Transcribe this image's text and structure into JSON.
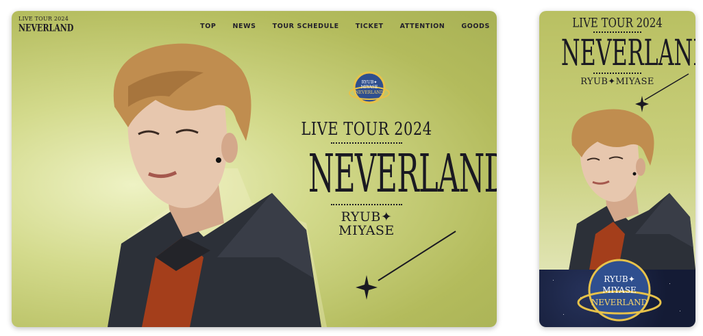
{
  "desktop": {
    "logo": {
      "line1": "LIVE TOUR 2024",
      "line2": "NEVERLAND"
    },
    "nav": [
      "TOP",
      "NEWS",
      "TOUR SCHEDULE",
      "TICKET",
      "ATTENTION",
      "GOODS"
    ],
    "hero": {
      "subtitle": "LIVE TOUR 2024",
      "title": "NEVERLAND",
      "artist_line1": "RYUB✦",
      "artist_line2": "MIYASE"
    },
    "badge": {
      "line1": "RYUB✦",
      "line2": "MIYASE",
      "line3": "NEVERLAND"
    }
  },
  "mobile": {
    "subtitle": "LIVE TOUR 2024",
    "title": "NEVERLAND",
    "artist": "RYUB✦MIYASE",
    "badge": {
      "line1": "RYUB✦",
      "line2": "MIYASE",
      "line3": "NEVERLAND"
    }
  },
  "colors": {
    "background_olive": "#b3bb5c",
    "text_dark": "#1a1922",
    "badge_blue": "#2f4f8f",
    "badge_gold": "#e7c24a"
  },
  "icons": [
    "sparkle-star-icon",
    "planet-badge-icon"
  ]
}
